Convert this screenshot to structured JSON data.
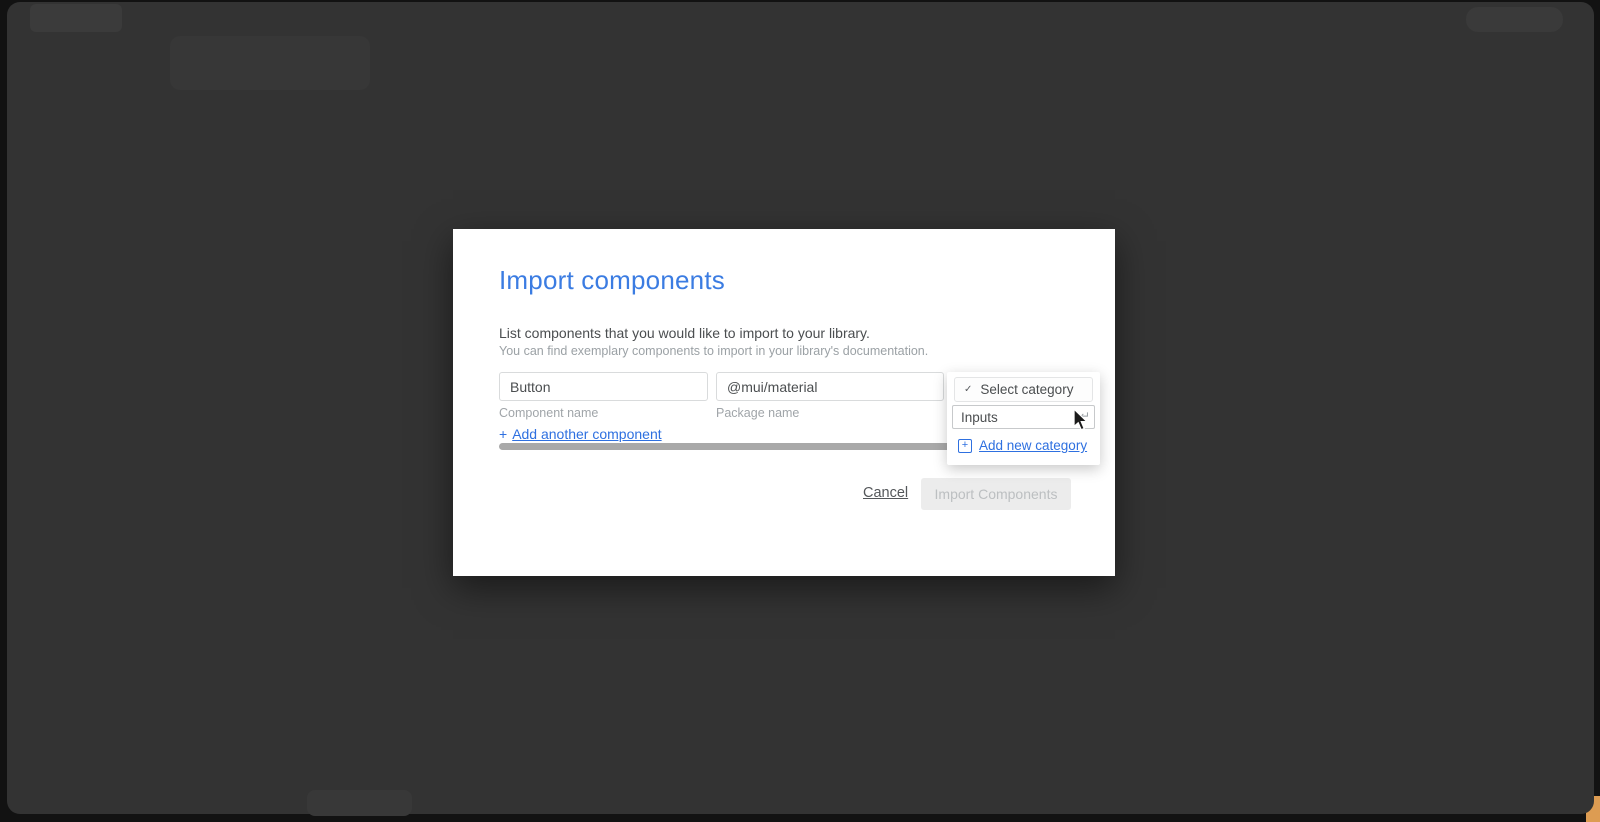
{
  "colors": {
    "overlay_background": "#333333",
    "title_blue": "#3b7ce2",
    "link_blue": "#2e70e0",
    "wallpaper_orange": "#dd9c52",
    "scrollbar_gray": "#a9a9a9",
    "disabled_button_bg": "#ececec"
  },
  "icons": {
    "plus": "+",
    "check": "✓",
    "return_key": "↵"
  },
  "modal": {
    "title": "Import components",
    "description": "List components that you would like to import to your library.",
    "hint": "You can find exemplary components to import in your library's documentation.",
    "component_name": {
      "value": "Button",
      "label": "Component name"
    },
    "package_name": {
      "value": "@mui/material",
      "label": "Package name"
    },
    "add_component_label": "Add another component",
    "cancel_label": "Cancel",
    "submit_label": "Import Components"
  },
  "category_dropdown": {
    "trigger_label": "Select category",
    "input_value": "Inputs",
    "add_new_label": "Add new category"
  }
}
